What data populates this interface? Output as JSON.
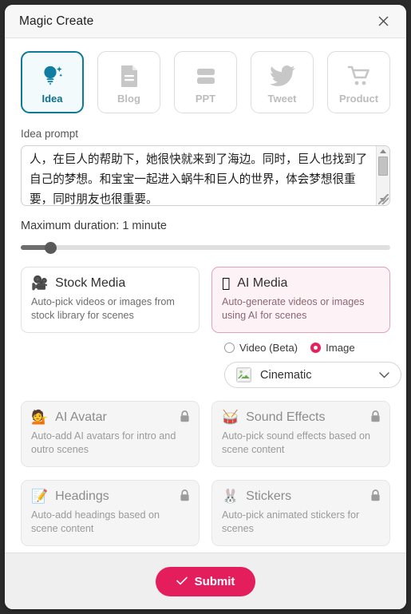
{
  "window": {
    "title": "Magic Create",
    "close_label": "×"
  },
  "tabs": [
    {
      "label": "Idea",
      "icon": "lightbulb-sparkle-icon",
      "selected": true
    },
    {
      "label": "Blog",
      "icon": "document-icon",
      "selected": false
    },
    {
      "label": "PPT",
      "icon": "slides-bars-icon",
      "selected": false
    },
    {
      "label": "Tweet",
      "icon": "twitter-bird-icon",
      "selected": false
    },
    {
      "label": "Product",
      "icon": "shopping-cart-icon",
      "selected": false
    }
  ],
  "prompt": {
    "label": "Idea prompt",
    "value": "人，在巨人的帮助下，她很快就来到了海边。同时，巨人也找到了自己的梦想。和宝宝一起进入蜗牛和巨人的世界，体会梦想很重要，同时朋友也很重要。",
    "placeholder": "Idea prompt"
  },
  "duration": {
    "label": "Maximum duration: 1 minute",
    "value_percent": 8
  },
  "media_cards": [
    {
      "title": "Stock Media",
      "emoji": "🎥",
      "icon": "movie-camera-icon",
      "desc": "Auto-pick videos or images from stock library for scenes",
      "selected": false,
      "locked": false
    },
    {
      "title": "AI Media",
      "emoji": "􀎸",
      "icon": "ai-media-icon",
      "desc": "Auto-generate videos or images using AI for scenes",
      "selected": true,
      "locked": false
    }
  ],
  "media_mode": {
    "options": [
      {
        "label": "Video (Beta)",
        "checked": false
      },
      {
        "label": "Image",
        "checked": true
      }
    ]
  },
  "style_select": {
    "value": "Cinematic",
    "icon": "broken-image-icon",
    "caret": "chevron-down-icon"
  },
  "feature_cards": [
    {
      "title": "AI Avatar",
      "emoji": "💁",
      "icon": "person-tipping-hand-icon",
      "desc": "Auto-add AI avatars for intro and outro scenes",
      "locked": true
    },
    {
      "title": "Sound Effects",
      "emoji": "🥁",
      "icon": "drum-icon",
      "desc": "Auto-pick sound effects based on scene content",
      "locked": true
    },
    {
      "title": "Headings",
      "emoji": "📝",
      "icon": "memo-icon",
      "desc": "Auto-add headings based on scene content",
      "locked": true
    },
    {
      "title": "Stickers",
      "emoji": "🐰",
      "icon": "rabbit-face-icon",
      "desc": "Auto-pick animated stickers for scenes",
      "locked": true
    }
  ],
  "footer": {
    "submit_label": "Submit",
    "submit_icon": "check-icon"
  },
  "colors": {
    "accent_teal": "#0d7a96",
    "accent_pink": "#e41e5c",
    "card_selected_bg": "#fdf3f6",
    "card_selected_border": "#e6a0b5"
  }
}
